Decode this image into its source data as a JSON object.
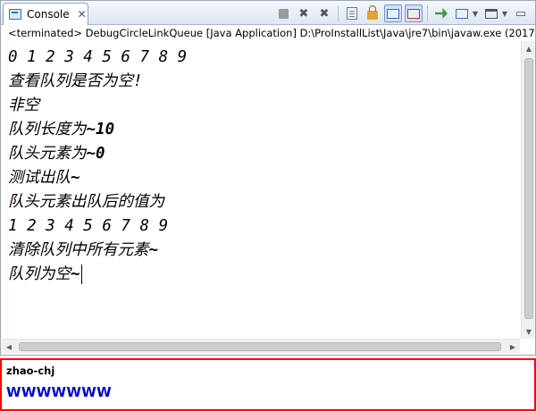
{
  "tab": {
    "label": "Console",
    "close": "✕"
  },
  "status": "<terminated> DebugCircleLinkQueue [Java Application] D:\\ProInstallList\\Java\\jre7\\bin\\javaw.exe (2017",
  "console_lines": [
    {
      "text": "0 1 2 3 4 5 6 7 8 9",
      "bold": ""
    },
    {
      "text": "查看队列是否为空!",
      "bold": ""
    },
    {
      "text": "非空",
      "bold": ""
    },
    {
      "text": "队列长度为",
      "bold": "~10"
    },
    {
      "text": "队头元素为",
      "bold": "~0"
    },
    {
      "text": "测试出队",
      "bold": "~"
    },
    {
      "text": "队头元素出队后的值为",
      "bold": ""
    },
    {
      "text": "1 2 3 4 5 6 7 8 9",
      "bold": ""
    },
    {
      "text": "清除队列中所有元素",
      "bold": "~"
    },
    {
      "text": "队列为空",
      "bold": "~"
    }
  ],
  "toolbar_icons": [
    "terminate-icon",
    "remove-launch-icon",
    "remove-all-terminated-icon",
    "clear-console-icon",
    "scroll-lock-icon",
    "show-on-stdout-icon",
    "show-on-stderr-icon",
    "pin-console-icon",
    "display-console-icon",
    "new-console-icon",
    "minimize-icon"
  ],
  "annotation": {
    "author": "zhao-chj",
    "text": "WWWWWWW"
  },
  "colors": {
    "annotation_border": "#ff0000",
    "annotation_text": "#0000cc"
  }
}
